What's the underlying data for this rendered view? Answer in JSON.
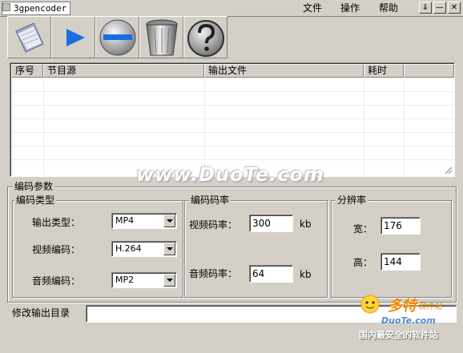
{
  "window": {
    "title": "3gpencoder",
    "menu": [
      "文件",
      "操作",
      "帮助"
    ],
    "win_buttons": [
      "⇓",
      "—",
      "✕"
    ]
  },
  "toolbar": {
    "items": [
      {
        "name": "open-file-button",
        "icon": "open-file-icon"
      },
      {
        "name": "start-encode-button",
        "icon": "play-icon"
      },
      {
        "name": "remove-item-button",
        "icon": "minus-circle-icon"
      },
      {
        "name": "clear-list-button",
        "icon": "trash-icon"
      },
      {
        "name": "help-button",
        "icon": "question-icon"
      }
    ]
  },
  "list": {
    "columns": [
      "序号",
      "节目源",
      "输出文件",
      "耗时"
    ],
    "rows": []
  },
  "encode_params": {
    "title": "编码参数",
    "type_group": {
      "title": "编码类型",
      "output_type_label": "输出类型：",
      "output_type_value": "MP4",
      "video_codec_label": "视频编码：",
      "video_codec_value": "H.264",
      "audio_codec_label": "音频编码：",
      "audio_codec_value": "MP2"
    },
    "bitrate_group": {
      "title": "编码码率",
      "video_bitrate_label": "视频码率：",
      "video_bitrate_value": "300",
      "audio_bitrate_label": "音频码率：",
      "audio_bitrate_value": "64",
      "unit": "kb"
    },
    "resolution_group": {
      "title": "分辨率",
      "width_label": "宽：",
      "width_value": "176",
      "height_label": "高：",
      "height_value": "144"
    }
  },
  "output_dir": {
    "label": "修改输出目录",
    "value": ""
  },
  "watermark": {
    "text": "www.DuoTe.com",
    "logo_cn": "多特",
    "logo_sub": "软件站",
    "logo_en": "DuoTe.com",
    "logo_tag": "国内最安全的软件站"
  },
  "colors": {
    "face": "#d4d0c8",
    "play_blue": "#1a6ee0",
    "logo_orange": "#f08a00",
    "logo_blue": "#4a8ad0"
  }
}
